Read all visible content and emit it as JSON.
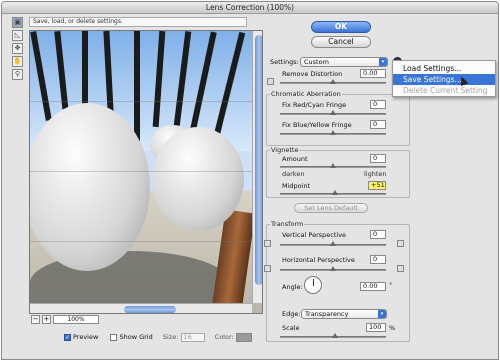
{
  "window": {
    "title": "Lens Correction (100%)"
  },
  "hint_text": "Save, load, or delete settings.",
  "tools": [
    {
      "name": "remove-distortion-tool-icon",
      "glyph": "▣"
    },
    {
      "name": "straighten-tool-icon",
      "glyph": "◺"
    },
    {
      "name": "move-grid-tool-icon",
      "glyph": "✥"
    },
    {
      "name": "hand-tool-icon",
      "glyph": "✋"
    },
    {
      "name": "zoom-tool-icon",
      "glyph": "⚲"
    }
  ],
  "zoom": {
    "minus": "−",
    "plus": "+",
    "value": "100%"
  },
  "bottom": {
    "preview_label": "Preview",
    "preview_checked": true,
    "show_grid_label": "Show Grid",
    "size_label": "Size:",
    "size_value": "16",
    "color_label": "Color:"
  },
  "buttons": {
    "ok": "OK",
    "cancel": "Cancel",
    "set_lens_default": "Set Lens Default"
  },
  "settings": {
    "label": "Settings:",
    "value": "Custom"
  },
  "remove_distortion": {
    "label": "Remove Distortion",
    "value": "0.00"
  },
  "chromatic": {
    "title": "Chromatic Aberration",
    "red_cyan_label": "Fix Red/Cyan Fringe",
    "red_cyan_value": "0",
    "blue_yellow_label": "Fix Blue/Yellow Fringe",
    "blue_yellow_value": "0"
  },
  "vignette": {
    "title": "Vignette",
    "amount_label": "Amount",
    "amount_value": "0",
    "darken": "darken",
    "lighten": "lighten",
    "midpoint_label": "Midpoint",
    "midpoint_value": "+51"
  },
  "transform": {
    "title": "Transform",
    "vertical_label": "Vertical Perspective",
    "vertical_value": "0",
    "horizontal_label": "Horizontal Perspective",
    "horizontal_value": "0",
    "angle_label": "Angle:",
    "angle_value": "0.00",
    "angle_unit": "°"
  },
  "edge": {
    "label": "Edge:",
    "value": "Transparency"
  },
  "scale": {
    "label": "Scale",
    "value": "100",
    "unit": "%"
  },
  "menu": {
    "items": [
      {
        "label": "Load Settings...",
        "state": "normal"
      },
      {
        "label": "Save Settings...",
        "state": "active"
      },
      {
        "label": "Delete Current Setting",
        "state": "disabled"
      }
    ]
  },
  "colors": {
    "accent": "#3875d7",
    "highlight": "#fff36b"
  }
}
